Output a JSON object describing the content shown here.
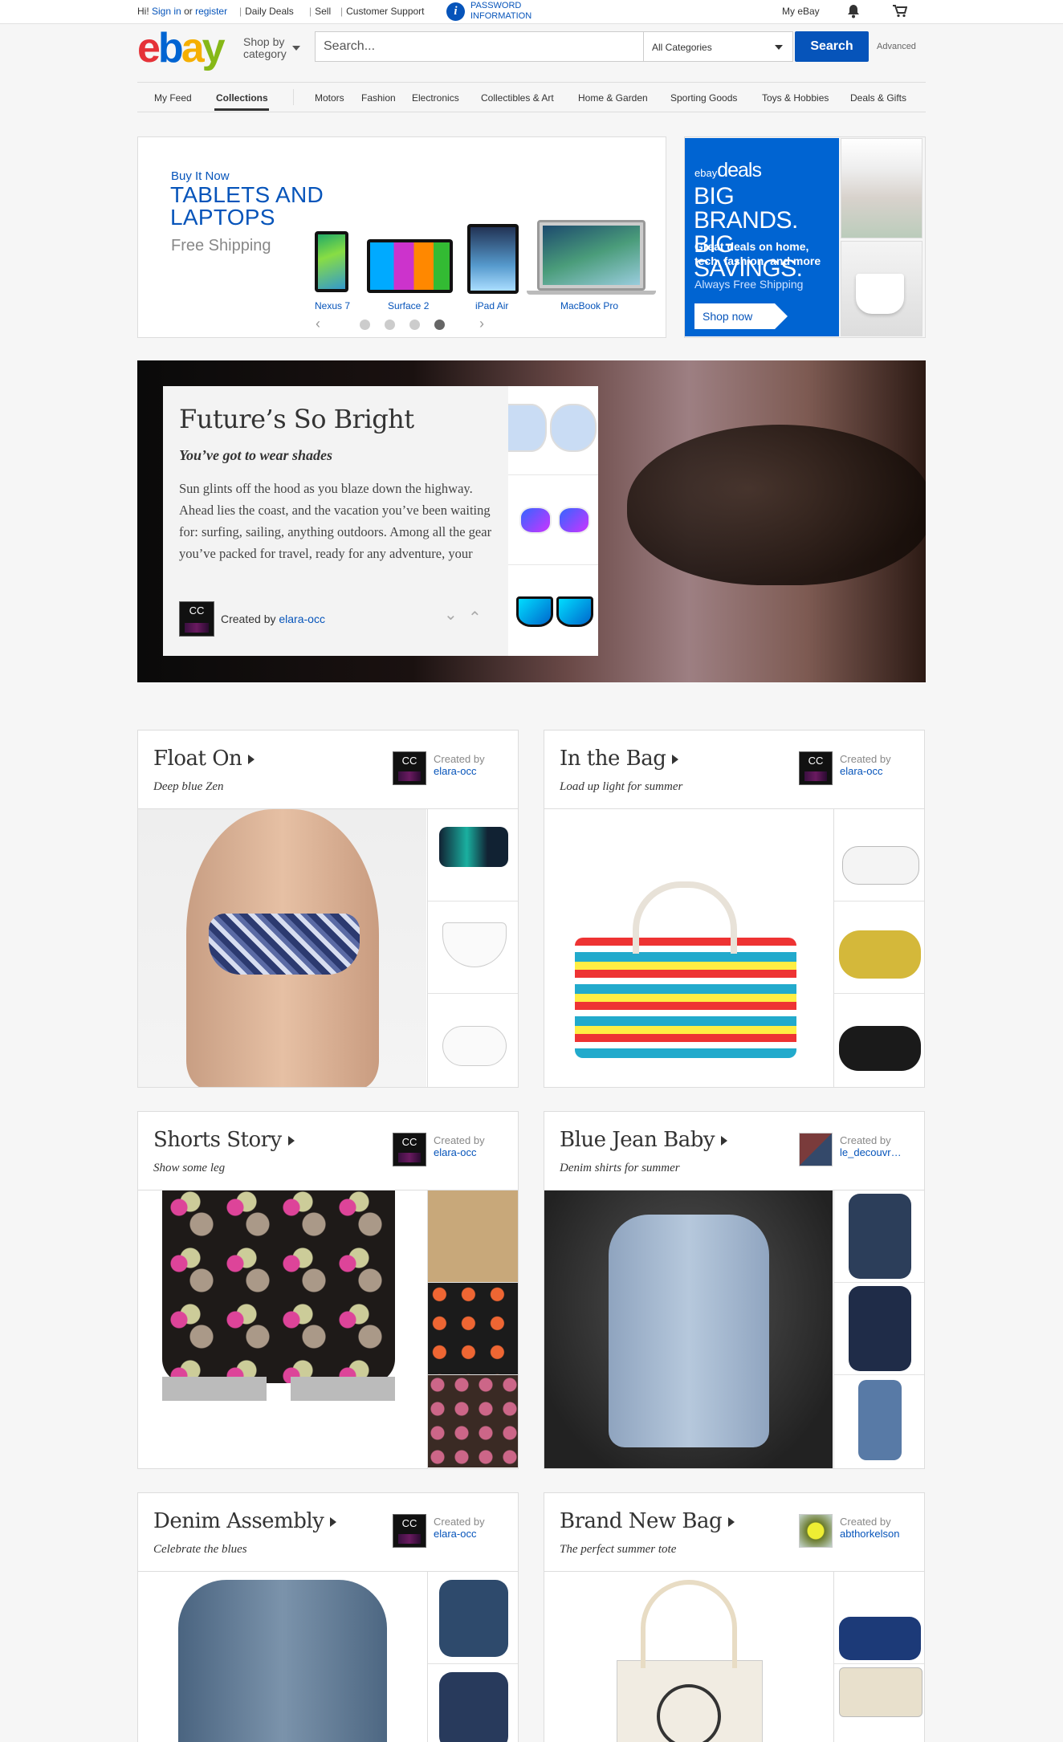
{
  "topbar": {
    "greeting": "Hi!",
    "sign_in": "Sign in",
    "or": "or",
    "register": "register",
    "daily_deals": "Daily Deals",
    "sell": "Sell",
    "customer_support": "Customer Support",
    "password_line1": "PASSWORD",
    "password_line2": "INFORMATION",
    "my_ebay": "My eBay"
  },
  "header": {
    "logo": {
      "e": "e",
      "b": "b",
      "a": "a",
      "y": "y"
    },
    "shop_by_line1": "Shop by",
    "shop_by_line2": "category",
    "search_placeholder": "Search...",
    "category_selected": "All Categories",
    "search_button": "Search",
    "advanced": "Advanced"
  },
  "nav": {
    "my_feed": "My Feed",
    "collections": "Collections",
    "categories": [
      "Motors",
      "Fashion",
      "Electronics",
      "Collectibles & Art",
      "Home & Garden",
      "Sporting Goods",
      "Toys & Hobbies",
      "Deals & Gifts"
    ]
  },
  "promo_tablets": {
    "kicker": "Buy It Now",
    "title_line1": "TABLETS AND",
    "title_line2": "LAPTOPS",
    "subtitle": "Free Shipping",
    "devices": [
      "Nexus 7",
      "Surface 2",
      "iPad Air",
      "MacBook Pro"
    ],
    "active_slide": 4,
    "slide_count": 4
  },
  "promo_deals": {
    "brand_small": "ebay",
    "brand": "deals",
    "headline_line1": "BIG BRANDS.",
    "headline_line2": "BIG SAVINGS.",
    "desc_line1": "Great deals on home,",
    "desc_line2": "tech, fashion, and more",
    "free_shipping": "Always Free Shipping",
    "button": "Shop now",
    "accent": "#0064d2"
  },
  "hero": {
    "title": "Future’s So Bright",
    "subtitle": "You’ve got to wear shades",
    "body": "Sun glints off the hood as you blaze down the highway. Ahead lies the coast, and the vacation you’ve been waiting for: surfing, sailing, anything outdoors. Among all the gear you’ve packed for travel, ready for any adventure, your",
    "avatar": "CC",
    "created_by": "Created by",
    "creator": "elara-occ"
  },
  "collections": [
    {
      "title": "Float On",
      "subtitle": "Deep blue Zen",
      "avatar": "CC",
      "created_by": "Created by",
      "creator": "elara-occ"
    },
    {
      "title": "In the Bag",
      "subtitle": "Load up light for summer",
      "avatar": "CC",
      "created_by": "Created by",
      "creator": "elara-occ"
    },
    {
      "title": "Shorts Story",
      "subtitle": "Show some leg",
      "avatar": "CC",
      "created_by": "Created by",
      "creator": "elara-occ"
    },
    {
      "title": "Blue Jean Baby",
      "subtitle": "Denim shirts for summer",
      "avatar": "",
      "created_by": "Created by",
      "creator": "le_decouvr…"
    },
    {
      "title": "Denim Assembly",
      "subtitle": "Celebrate the blues",
      "avatar": "CC",
      "created_by": "Created by",
      "creator": "elara-occ"
    },
    {
      "title": "Brand New Bag",
      "subtitle": "The perfect summer tote",
      "avatar": "",
      "created_by": "Created by",
      "creator": "abthorkelson"
    }
  ]
}
